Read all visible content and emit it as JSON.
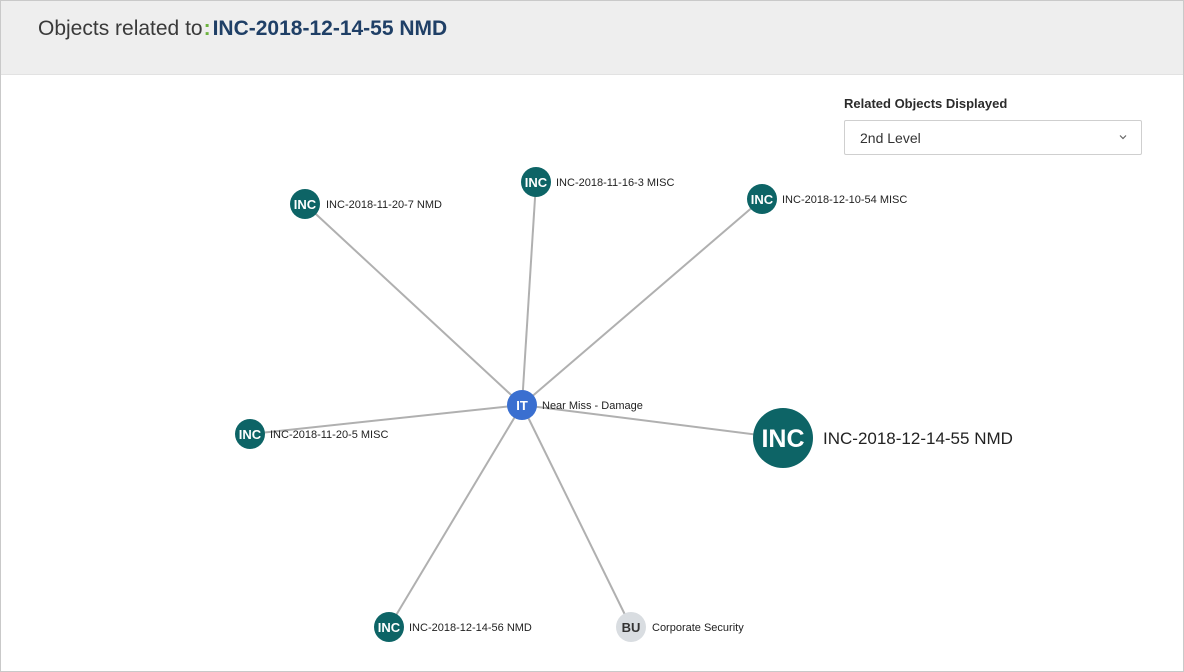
{
  "header": {
    "prefix": "Objects related to",
    "colon": ":",
    "object_name": "INC-2018-12-14-55 NMD"
  },
  "filter": {
    "label": "Related Objects Displayed",
    "selected": "2nd Level",
    "icon": "chevron-down-icon"
  },
  "colors": {
    "incident_node": "#0d6466",
    "type_node": "#3a6fd0",
    "business_unit_node": "#d9dde1",
    "edge": "#b0b0b0",
    "title_object": "#1f3f66",
    "colon_accent": "#6db33f"
  },
  "graph": {
    "center": {
      "badge": "IT",
      "label": "Near Miss - Damage"
    },
    "nodes": [
      {
        "badge": "INC",
        "label": "INC-2018-11-20-7 NMD"
      },
      {
        "badge": "INC",
        "label": "INC-2018-11-16-3 MISC"
      },
      {
        "badge": "INC",
        "label": "INC-2018-12-10-54 MISC"
      },
      {
        "badge": "INC",
        "label": "INC-2018-11-20-5 MISC"
      },
      {
        "badge": "INC",
        "label": "INC-2018-12-14-55 NMD"
      },
      {
        "badge": "INC",
        "label": "INC-2018-12-14-56 NMD"
      },
      {
        "badge": "BU",
        "label": "Corporate Security"
      }
    ]
  }
}
